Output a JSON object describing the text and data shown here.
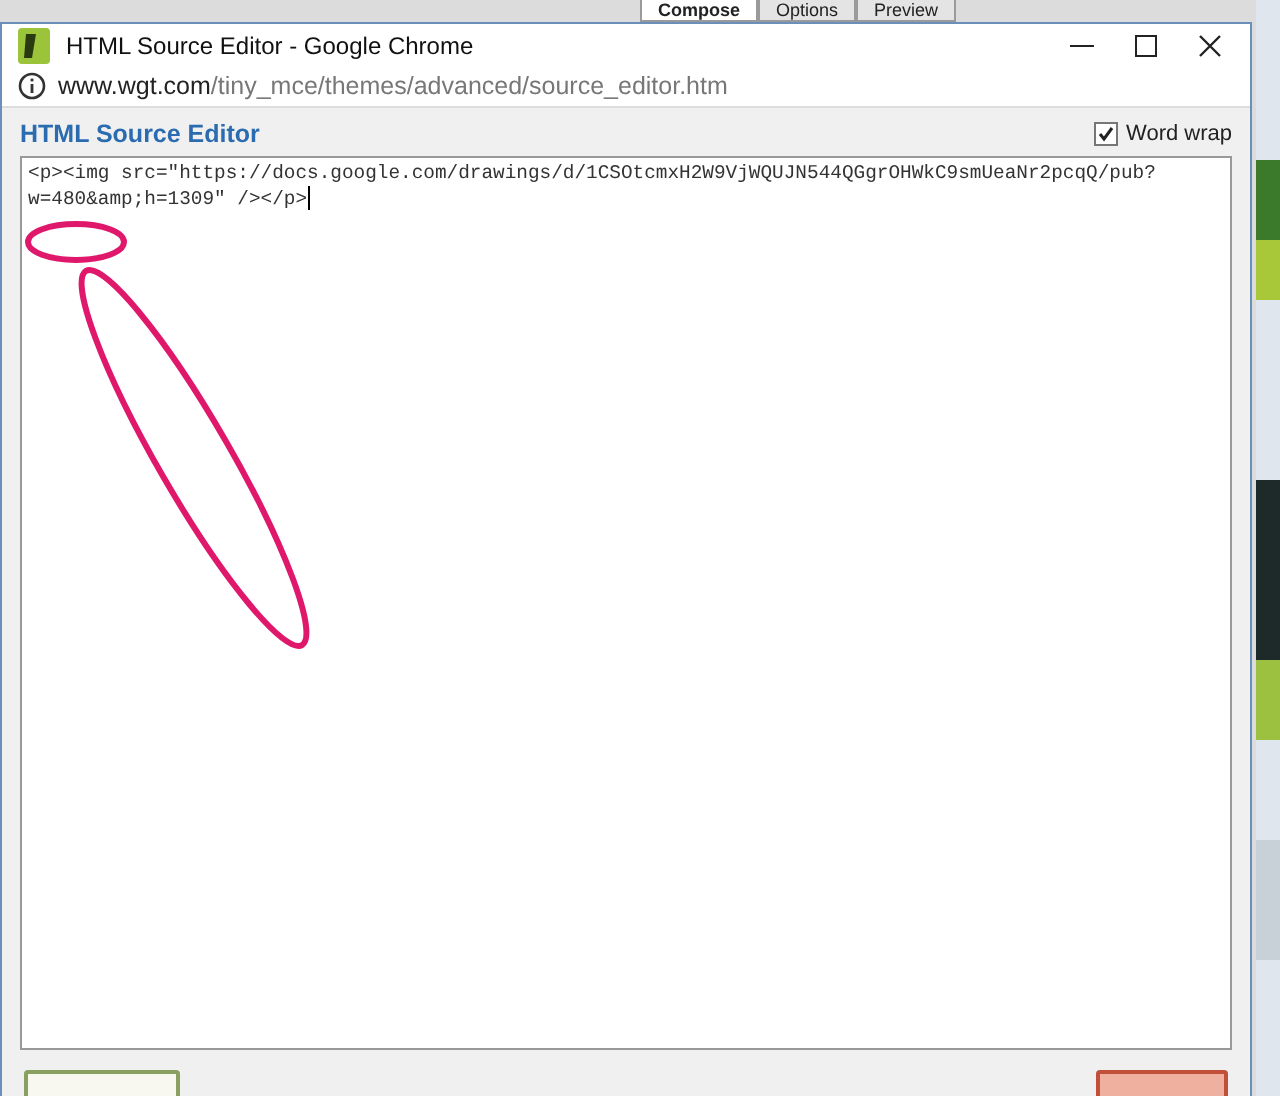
{
  "background_page": {
    "tabs": [
      {
        "label": "Compose",
        "selected": true
      },
      {
        "label": "Options",
        "selected": false
      },
      {
        "label": "Preview",
        "selected": false
      }
    ]
  },
  "window": {
    "title": "HTML Source Editor - Google Chrome",
    "address": {
      "host": "www.wgt.com",
      "path": "/tiny_mce/themes/advanced/source_editor.htm"
    }
  },
  "editor": {
    "heading": "HTML Source Editor",
    "word_wrap": {
      "label": "Word wrap",
      "checked": true
    },
    "source": "<p><img src=\"https://docs.google.com/drawings/d/1CSOtcmxH2W9VjWQUJN544QGgrOHWkC9smUeaNr2pcqQ/pub?w=480&amp;h=1309\" /></p>"
  },
  "buttons": [
    {
      "kind": "insert"
    },
    {
      "kind": "cancel"
    }
  ]
}
